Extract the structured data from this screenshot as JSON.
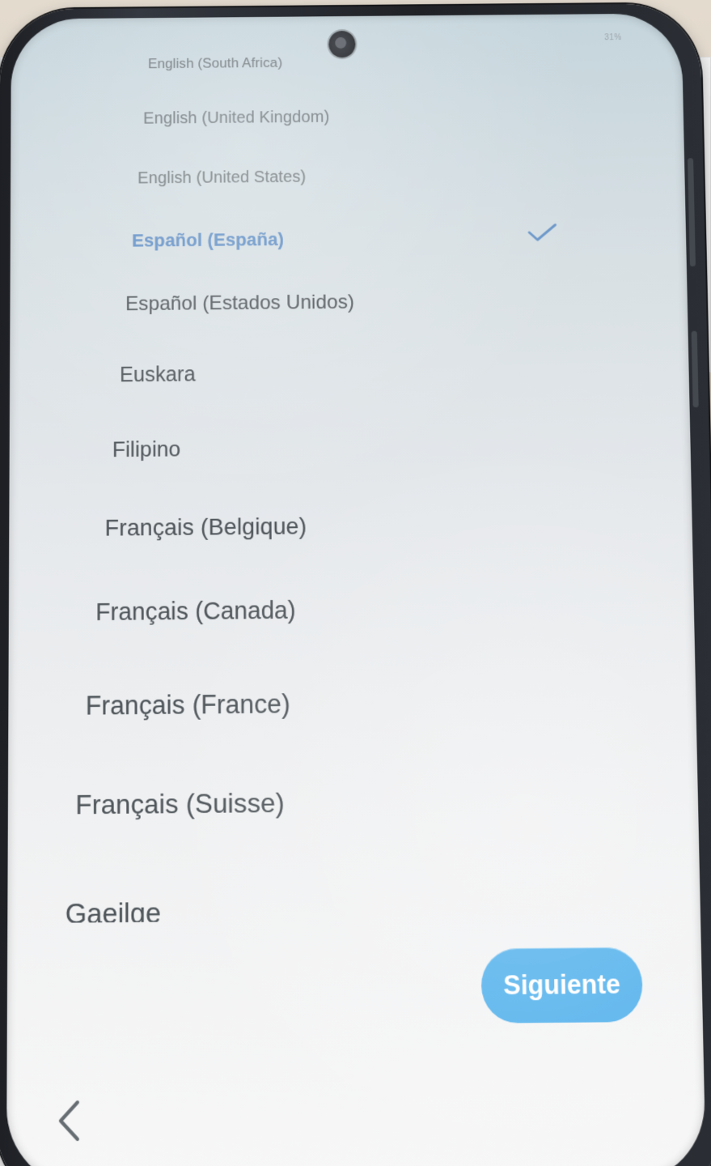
{
  "status_bar": {
    "text": "31%"
  },
  "languages": [
    {
      "label": "English (South Africa)"
    },
    {
      "label": "English (United Kingdom)"
    },
    {
      "label": "English (United States)"
    },
    {
      "label": "Español (España)",
      "selected": true
    },
    {
      "label": "Español (Estados Unidos)"
    },
    {
      "label": "Euskara"
    },
    {
      "label": "Filipino"
    },
    {
      "label": "Français (Belgique)"
    },
    {
      "label": "Français (Canada)"
    },
    {
      "label": "Français (France)"
    },
    {
      "label": "Français (Suisse)"
    },
    {
      "label": "Gaeilge"
    }
  ],
  "actions": {
    "next_label": "Siguiente"
  },
  "icons": {
    "selected": "checkmark-icon",
    "back": "back-chevron-icon"
  },
  "colors": {
    "accent": "#5f8fc7",
    "button": "#53b1ec",
    "text": "#4f565b"
  }
}
